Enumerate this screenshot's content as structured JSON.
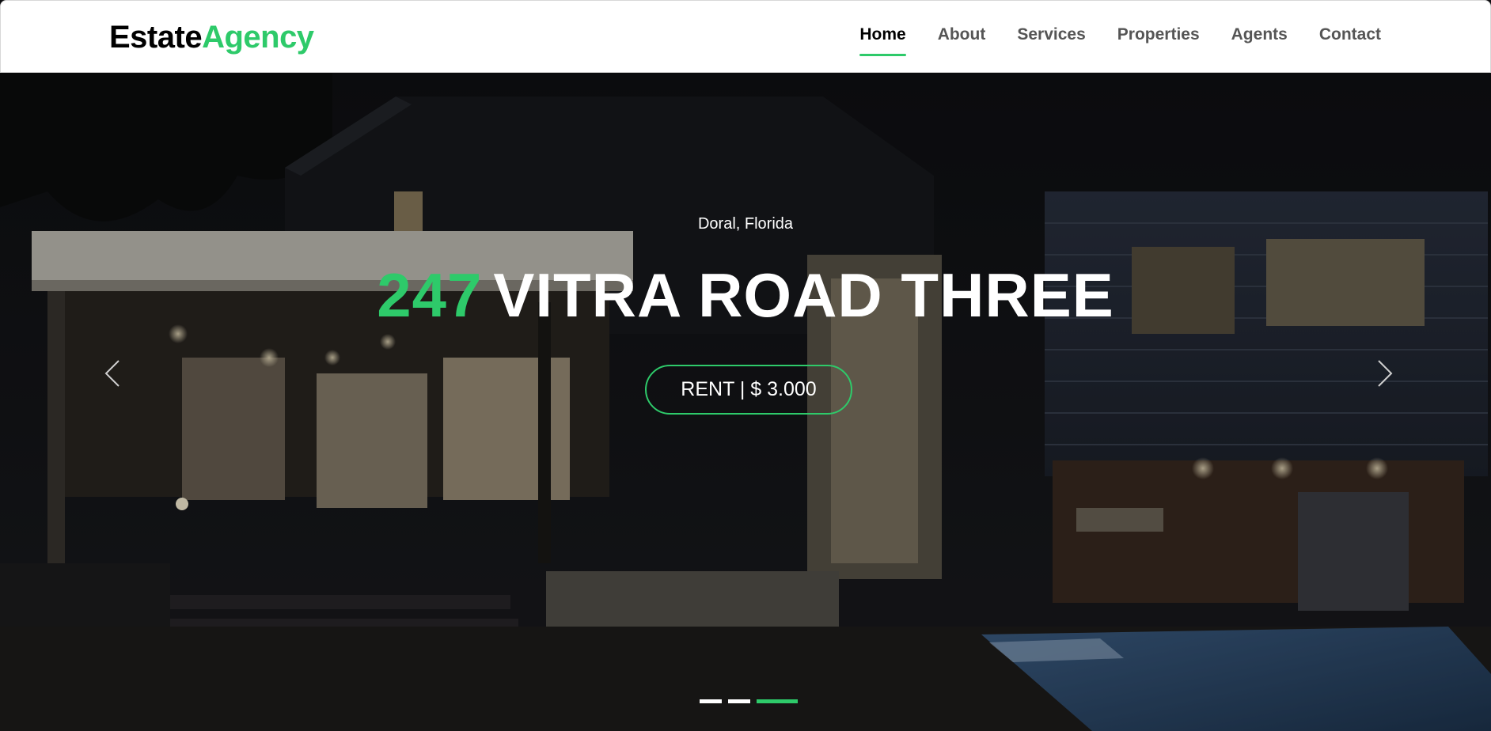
{
  "brand": {
    "part1": "Estate",
    "part2": "Agency"
  },
  "nav": {
    "items": [
      {
        "label": "Home",
        "active": true
      },
      {
        "label": "About",
        "active": false
      },
      {
        "label": "Services",
        "active": false
      },
      {
        "label": "Properties",
        "active": false
      },
      {
        "label": "Agents",
        "active": false
      },
      {
        "label": "Contact",
        "active": false
      }
    ]
  },
  "hero": {
    "location": "Doral, Florida",
    "title_number": "247",
    "title_text": "VITRA ROAD THREE",
    "cta_label": "RENT | $ 3.000",
    "prev_icon": "chevron-left-icon",
    "next_icon": "chevron-right-icon",
    "slides": {
      "count": 3,
      "active_index": 2
    }
  },
  "colors": {
    "accent": "#2eca6a",
    "nav_text": "#555555",
    "nav_active": "#000000"
  }
}
